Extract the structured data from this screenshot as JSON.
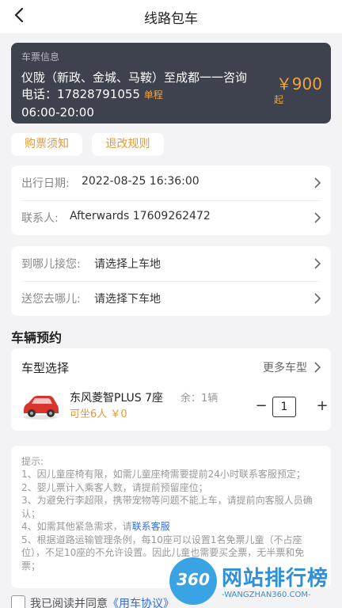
{
  "header": {
    "title": "线路包车",
    "back_icon": "chevron-left-icon"
  },
  "ticket": {
    "label": "车票信息",
    "route_line1": "仪陇（新政、金城、马鞍）至成都一一咨询",
    "route_line2": "电话：17828791055",
    "trip_type": "单程",
    "time": "06:00-20:00",
    "price": "￥900",
    "price_unit": "起",
    "bg_color": "#3e414e",
    "accent_color": "#f0a53d"
  },
  "actions": {
    "purchase_notes": "购票须知",
    "refund_rules": "退改规则"
  },
  "trip": {
    "date_label": "出行日期:",
    "date_value": "2022-08-25 16:36:00",
    "contact_label": "联系人:",
    "contact_value": "Afterwards 17609262472"
  },
  "locations": {
    "pickup_label": "到哪儿接您:",
    "pickup_value": "请选择上车地",
    "dropoff_label": "送您去哪儿:",
    "dropoff_value": "请选择下车地"
  },
  "vehicle": {
    "section_title": "车辆预约",
    "type_label": "车型选择",
    "more_types": "更多车型",
    "car_name": "东风菱智PLUS 7座",
    "remaining": "余：1辆",
    "seats_price": "可坐6人 ￥0",
    "minus": "−",
    "plus": "+",
    "quantity": "1",
    "car_icon": "red-car-icon"
  },
  "notes": {
    "title": "提示:",
    "item1": "1、因儿童座椅有限，如需儿童座椅需要提前24小时联系客服预定；",
    "item2": "2、婴儿票计入乘客人数，请提前预留座位；",
    "item3": "3、为避免行李超限，携带宠物等问题不能上车，请提前向客服人员确认；",
    "item4_prefix": "4、如需其他紧急需求，请",
    "item4_link": "联系客服",
    "item5": "5、根据道路运输管理条例，每10座可以设置1名免票儿童（不占座位），不足10座的不允许设置。因此儿童也需要买全票，无半票和免票；"
  },
  "agreement": {
    "prefix": "我已阅读并同意",
    "link": "《用车协议》"
  },
  "watermark": {
    "badge": "360",
    "brand": "网站排行榜",
    "url": "-WANGZHAN360.COM-"
  }
}
